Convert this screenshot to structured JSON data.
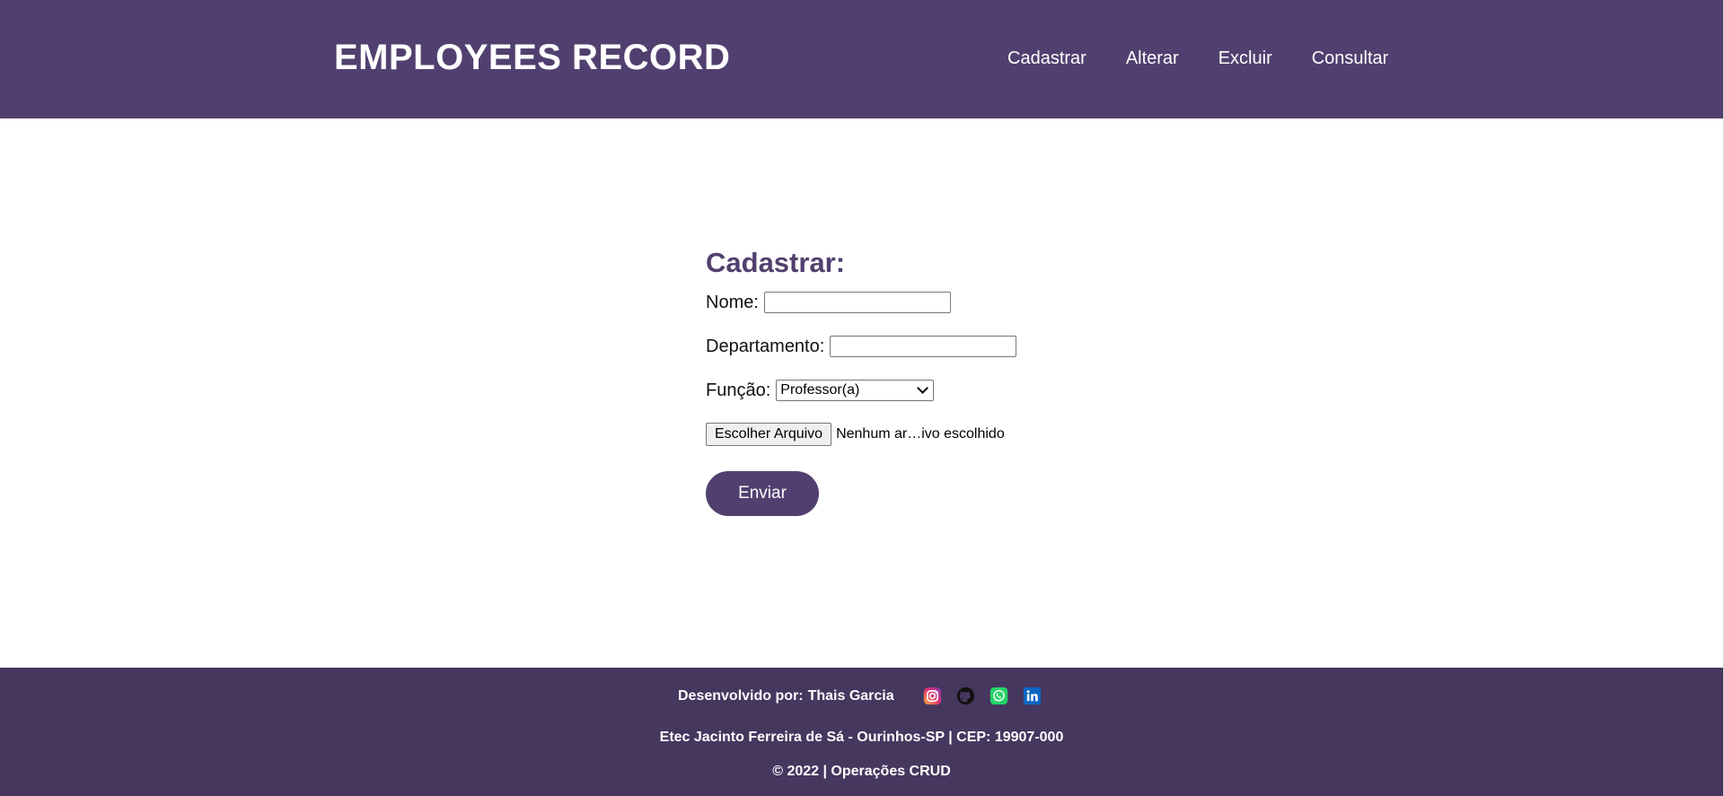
{
  "header": {
    "title": "EMPLOYEES RECORD",
    "nav": [
      {
        "label": "Cadastrar"
      },
      {
        "label": "Alterar"
      },
      {
        "label": "Excluir"
      },
      {
        "label": "Consultar"
      }
    ]
  },
  "form": {
    "title": "Cadastrar:",
    "nome_label": "Nome:",
    "nome_value": "",
    "departamento_label": "Departamento:",
    "departamento_value": "",
    "funcao_label": "Função:",
    "funcao_selected": "Professor(a)",
    "file_button_label": "Escolher Arquivo",
    "file_status": "Nenhum ar…ivo escolhido",
    "submit_label": "Enviar"
  },
  "footer": {
    "developed_by_label": "Desenvolvido por:",
    "developer_name": "Thais Garcia",
    "social_icons": [
      "instagram-icon",
      "github-icon",
      "whatsapp-icon",
      "linkedin-icon"
    ],
    "address": "Etec Jacinto Ferreira de Sá - Ourinhos-SP | CEP: 19907-000",
    "copyright": "© 2022 | Operações CRUD"
  },
  "colors": {
    "header_bg": "#51406f",
    "footer_bg": "#46375f",
    "accent": "#51406f",
    "instagram": "#e1306c",
    "whatsapp": "#25d366",
    "linkedin": "#0a66c2"
  }
}
